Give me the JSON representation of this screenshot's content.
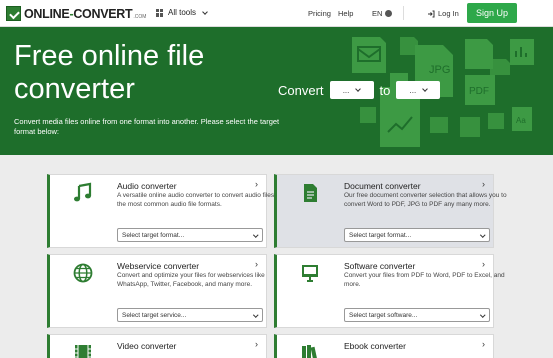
{
  "header": {
    "logo_text_a": "ONLINE",
    "logo_text_dash": "-",
    "logo_text_b": "CONVERT",
    "logo_suffix": ".COM",
    "all_tools": "All tools",
    "pricing": "Pricing",
    "help": "Help",
    "language": "EN",
    "login": "Log In",
    "signup": "Sign Up"
  },
  "hero": {
    "title": "Free online file converter",
    "subtitle": "Convert media files online from one format into another. Please select the target format below:",
    "convert_label": "Convert",
    "to_label": "to",
    "from_select": "...",
    "to_select": "...",
    "deco_labels": [
      "JPG",
      "PDF",
      "Aa"
    ]
  },
  "colors": {
    "brand_green": "#1e6e2b",
    "button_green": "#2ea84a",
    "accent_border": "#2e7d32"
  },
  "cards": [
    {
      "title": "Audio converter",
      "desc": "A versatile online audio converter to convert audio files in the most common audio file formats.",
      "select": "Select target format...",
      "icon": "music-note-icon"
    },
    {
      "title": "Document converter",
      "desc": "Our free document converter selection that allows you to convert Word to PDF, JPG to PDF any many more.",
      "select": "Select target format...",
      "icon": "document-icon"
    },
    {
      "title": "Webservice converter",
      "desc": "Convert and optimize your files for webservices like WhatsApp, Twitter, Facebook, and many more.",
      "select": "Select target service...",
      "icon": "globe-icon"
    },
    {
      "title": "Software converter",
      "desc": "Convert your files from PDF to Word, PDF to Excel, and more.",
      "select": "Select target software...",
      "icon": "monitor-icon"
    },
    {
      "title": "Video converter",
      "desc": "",
      "select": "",
      "icon": "film-icon"
    },
    {
      "title": "Ebook converter",
      "desc": "",
      "select": "",
      "icon": "books-icon"
    }
  ]
}
